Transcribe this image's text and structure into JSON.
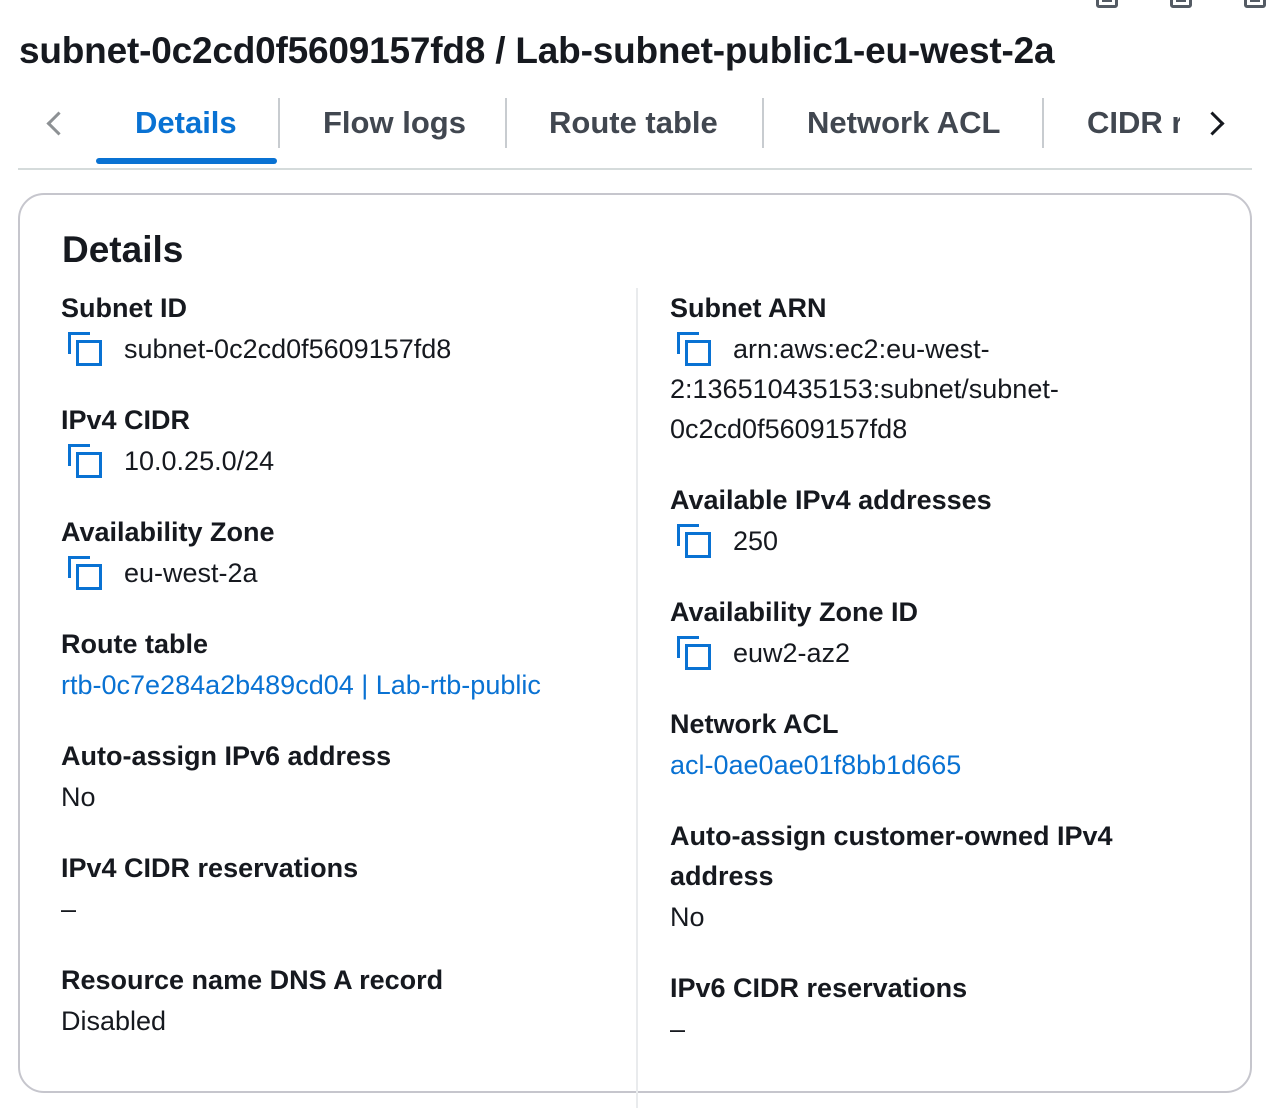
{
  "header": {
    "title": "subnet-0c2cd0f5609157fd8 / Lab-subnet-public1-eu-west-2a"
  },
  "tabs": [
    {
      "label": "Details",
      "active": true
    },
    {
      "label": "Flow logs"
    },
    {
      "label": "Route table"
    },
    {
      "label": "Network ACL"
    },
    {
      "label": "CIDR r"
    }
  ],
  "panel": {
    "title": "Details",
    "left": {
      "subnet_id": {
        "label": "Subnet ID",
        "value": "subnet-0c2cd0f5609157fd8"
      },
      "ipv4_cidr": {
        "label": "IPv4 CIDR",
        "value": "10.0.25.0/24"
      },
      "availability_zone": {
        "label": "Availability Zone",
        "value": "eu-west-2a"
      },
      "route_table": {
        "label": "Route table",
        "value": "rtb-0c7e284a2b489cd04 | Lab-rtb-public"
      },
      "auto_ipv6": {
        "label": "Auto-assign IPv6 address",
        "value": "No"
      },
      "ipv4_reservations": {
        "label": "IPv4 CIDR reservations",
        "value": "–"
      },
      "dns_a_record": {
        "label": "Resource name DNS A record",
        "value": "Disabled"
      }
    },
    "right": {
      "subnet_arn": {
        "label": "Subnet ARN",
        "line1": "arn:aws:ec2:eu-west-",
        "line2": "2:136510435153:subnet/subnet-",
        "line3": "0c2cd0f5609157fd8"
      },
      "available_ipv4": {
        "label": "Available IPv4 addresses",
        "value": "250"
      },
      "az_id": {
        "label": "Availability Zone ID",
        "value": "euw2-az2"
      },
      "network_acl": {
        "label": "Network ACL",
        "value": "acl-0ae0ae01f8bb1d665"
      },
      "auto_customer_ipv4": {
        "label_line1": "Auto-assign customer-owned IPv4",
        "label_line2": "address",
        "value": "No"
      },
      "ipv6_reservations": {
        "label": "IPv6 CIDR reservations",
        "value": "–"
      }
    }
  },
  "colors": {
    "link": "#0972d3",
    "text": "#16191f",
    "tab_inactive": "#414750"
  }
}
